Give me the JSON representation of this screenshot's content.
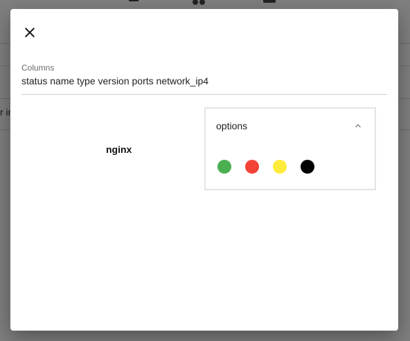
{
  "dialog": {
    "close_icon": "close-icon",
    "columns_field": {
      "label": "Columns",
      "value": "status name type version ports network_ip4"
    },
    "item_name": "nginx",
    "options": {
      "title": "options",
      "expand_icon": "chevron-up-icon",
      "colors": [
        "#4caf50",
        "#f44336",
        "#ffeb3b",
        "#000000"
      ]
    }
  },
  "background": {
    "partial_text": "r in"
  }
}
